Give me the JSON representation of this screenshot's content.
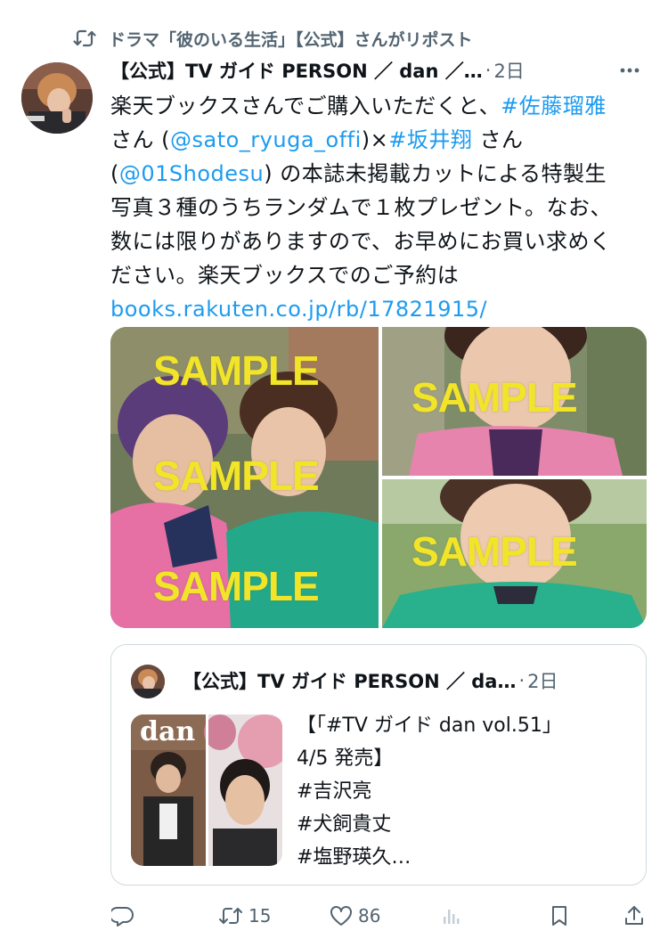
{
  "repost": {
    "icon": "repost-icon",
    "text": "ドラマ「彼のいる生活」【公式】さんがリポスト"
  },
  "tweet": {
    "author_name": "【公式】TV ガイド PERSON ／ dan ／…",
    "time": "2日",
    "text": {
      "l1_a": "楽天ブックスさんでご購入いただくと、",
      "l1_tag": "#佐藤瑠雅",
      "l2_a": "さん (",
      "l2_mention": "@sato_ryuga_offi",
      "l2_b": ")×",
      "l2_tag": "#坂井翔",
      "l2_c": " さん",
      "l3_a": "(",
      "l3_mention": "@01Shodesu",
      "l3_b": ") の本誌未掲載カットによる特製生",
      "l4": "写真３種のうちランダムで１枚プレゼント。なお、",
      "l5": "数には限りがありますので、お早めにお買い求めく",
      "l6": "ださい。楽天ブックスでのご予約は",
      "link": "books.rakuten.co.jp/rb/17821915/"
    },
    "media": {
      "watermark": "SAMPLE"
    }
  },
  "quote": {
    "author_name": "【公式】TV ガイド PERSON ／ da…",
    "time": "2日",
    "thumb_title": "dan",
    "text": {
      "l1": "【「#TV ガイド dan vol.51」",
      "l2": "4/5 発売】",
      "l3": "#吉沢亮",
      "l4": "#犬飼貴丈",
      "l5": "#塩野瑛久…"
    }
  },
  "actions": {
    "reply": {
      "icon": "reply-icon",
      "count": ""
    },
    "retweet": {
      "icon": "retweet-icon",
      "count": "15"
    },
    "like": {
      "icon": "like-icon",
      "count": "86"
    },
    "views": {
      "icon": "views-icon",
      "count": ""
    },
    "bookmark": {
      "icon": "bookmark-icon"
    },
    "share": {
      "icon": "share-icon"
    }
  },
  "colors": {
    "link": "#1d9bf0",
    "muted": "#536471",
    "text": "#0f1419",
    "border": "#cfd9de",
    "watermark": "#f2e529"
  }
}
